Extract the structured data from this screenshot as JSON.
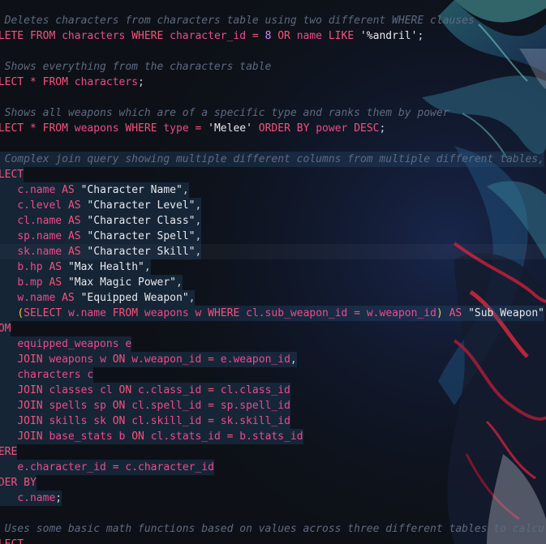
{
  "editor": {
    "language": "sql",
    "theme_colors": {
      "background": "#0d1117",
      "keyword": "#f7527a",
      "identifier": "#ee4a8a",
      "string": "#e8e8ee",
      "comment": "#5e6a80",
      "number": "#c78dfa",
      "selection": "#285278"
    },
    "lines": [
      {
        "comment": "- Deletes characters from characters table using two different WHERE clauses"
      },
      {
        "tokens": [
          [
            "kw",
            "ELETE FROM "
          ],
          [
            "id",
            "characters "
          ],
          [
            "kw",
            "WHERE "
          ],
          [
            "id",
            "character_id "
          ],
          [
            "op",
            "= "
          ],
          [
            "num",
            "8 "
          ],
          [
            "kw",
            "OR "
          ],
          [
            "id",
            "name "
          ],
          [
            "kw",
            "LIKE "
          ],
          [
            "str",
            "'%andril'"
          ],
          [
            "pl",
            ";"
          ]
        ]
      },
      {
        "comment": ""
      },
      {
        "comment": "- Shows everything from the characters table"
      },
      {
        "tokens": [
          [
            "kw",
            "ELECT "
          ],
          [
            "op",
            "* "
          ],
          [
            "kw",
            "FROM "
          ],
          [
            "id",
            "characters"
          ],
          [
            "pl",
            ";"
          ]
        ]
      },
      {
        "comment": ""
      },
      {
        "comment": "- Shows all weapons which are of a specific type and ranks them by power"
      },
      {
        "tokens": [
          [
            "kw",
            "ELECT "
          ],
          [
            "op",
            "* "
          ],
          [
            "kw",
            "FROM "
          ],
          [
            "id",
            "weapons "
          ],
          [
            "kw",
            "WHERE "
          ],
          [
            "id",
            "type "
          ],
          [
            "op",
            "= "
          ],
          [
            "str",
            "'Melee' "
          ],
          [
            "kw",
            "ORDER BY "
          ],
          [
            "id",
            "power "
          ],
          [
            "kw",
            "DESC"
          ],
          [
            "pl",
            ";"
          ]
        ]
      },
      {
        "comment": ""
      },
      {
        "comment": "- Complex join query showing multiple different columns from multiple different tables,",
        "selected": true
      },
      {
        "tokens": [
          [
            "kw",
            "ELECT"
          ]
        ],
        "selected": true
      },
      {
        "tokens": [
          [
            "pl",
            "    "
          ],
          [
            "id",
            "c.name "
          ],
          [
            "kw",
            "AS "
          ],
          [
            "str",
            "\"Character Name\""
          ],
          [
            "pl",
            ","
          ]
        ],
        "selected": true
      },
      {
        "tokens": [
          [
            "pl",
            "    "
          ],
          [
            "id",
            "c.level "
          ],
          [
            "kw",
            "AS "
          ],
          [
            "str",
            "\"Character Level\""
          ],
          [
            "pl",
            ","
          ]
        ],
        "selected": true
      },
      {
        "tokens": [
          [
            "pl",
            "    "
          ],
          [
            "id",
            "cl.name "
          ],
          [
            "kw",
            "AS "
          ],
          [
            "str",
            "\"Character Class\""
          ],
          [
            "pl",
            ","
          ]
        ],
        "selected": true
      },
      {
        "tokens": [
          [
            "pl",
            "    "
          ],
          [
            "id",
            "sp.name "
          ],
          [
            "kw",
            "AS "
          ],
          [
            "str",
            "\"Character Spell\""
          ],
          [
            "pl",
            ","
          ]
        ],
        "selected": true
      },
      {
        "tokens": [
          [
            "pl",
            "    "
          ],
          [
            "id",
            "sk.name "
          ],
          [
            "kw",
            "AS "
          ],
          [
            "str",
            "\"Character Skill\""
          ],
          [
            "pl",
            ","
          ]
        ],
        "selected": true,
        "cursor": true
      },
      {
        "tokens": [
          [
            "pl",
            "    "
          ],
          [
            "id",
            "b.hp "
          ],
          [
            "kw",
            "AS "
          ],
          [
            "str",
            "\"Max Health\""
          ],
          [
            "pl",
            ","
          ]
        ],
        "selected": true
      },
      {
        "tokens": [
          [
            "pl",
            "    "
          ],
          [
            "id",
            "b.mp "
          ],
          [
            "kw",
            "AS "
          ],
          [
            "str",
            "\"Max Magic Power\""
          ],
          [
            "pl",
            ","
          ]
        ],
        "selected": true
      },
      {
        "tokens": [
          [
            "pl",
            "    "
          ],
          [
            "id",
            "w.name "
          ],
          [
            "kw",
            "AS "
          ],
          [
            "str",
            "\"Equipped Weapon\""
          ],
          [
            "pl",
            ","
          ]
        ],
        "selected": true
      },
      {
        "tokens": [
          [
            "pl",
            "    "
          ],
          [
            "pa",
            "("
          ],
          [
            "kw",
            "SELECT "
          ],
          [
            "id",
            "w.name "
          ],
          [
            "kw",
            "FROM "
          ],
          [
            "id",
            "weapons w "
          ],
          [
            "kw",
            "WHERE "
          ],
          [
            "id",
            "cl.sub_weapon_id "
          ],
          [
            "op",
            "= "
          ],
          [
            "id",
            "w.weapon_id"
          ],
          [
            "pa",
            ") "
          ],
          [
            "kw",
            "AS "
          ],
          [
            "str",
            "\"Sub Weapon\""
          ]
        ],
        "selected": true
      },
      {
        "tokens": [
          [
            "kw",
            "ROM"
          ]
        ],
        "selected": true
      },
      {
        "tokens": [
          [
            "pl",
            "    "
          ],
          [
            "id",
            "equipped_weapons e"
          ]
        ],
        "selected": true
      },
      {
        "tokens": [
          [
            "pl",
            "    "
          ],
          [
            "kw",
            "JOIN "
          ],
          [
            "id",
            "weapons w "
          ],
          [
            "kw",
            "ON "
          ],
          [
            "id",
            "w.weapon_id "
          ],
          [
            "op",
            "= "
          ],
          [
            "id",
            "e.weapon_id"
          ],
          [
            "pl",
            ","
          ]
        ],
        "selected": true
      },
      {
        "tokens": [
          [
            "pl",
            "    "
          ],
          [
            "id",
            "characters c"
          ]
        ],
        "selected": true
      },
      {
        "tokens": [
          [
            "pl",
            "    "
          ],
          [
            "kw",
            "JOIN "
          ],
          [
            "id",
            "classes cl "
          ],
          [
            "kw",
            "ON "
          ],
          [
            "id",
            "c.class_id "
          ],
          [
            "op",
            "= "
          ],
          [
            "id",
            "cl.class_id"
          ]
        ],
        "selected": true
      },
      {
        "tokens": [
          [
            "pl",
            "    "
          ],
          [
            "kw",
            "JOIN "
          ],
          [
            "id",
            "spells sp "
          ],
          [
            "kw",
            "ON "
          ],
          [
            "id",
            "cl.spell_id "
          ],
          [
            "op",
            "= "
          ],
          [
            "id",
            "sp.spell_id"
          ]
        ],
        "selected": true
      },
      {
        "tokens": [
          [
            "pl",
            "    "
          ],
          [
            "kw",
            "JOIN "
          ],
          [
            "id",
            "skills sk "
          ],
          [
            "kw",
            "ON "
          ],
          [
            "id",
            "cl.skill_id "
          ],
          [
            "op",
            "= "
          ],
          [
            "id",
            "sk.skill_id"
          ]
        ],
        "selected": true
      },
      {
        "tokens": [
          [
            "pl",
            "    "
          ],
          [
            "kw",
            "JOIN "
          ],
          [
            "id",
            "base_stats b "
          ],
          [
            "kw",
            "ON "
          ],
          [
            "id",
            "cl.stats_id "
          ],
          [
            "op",
            "= "
          ],
          [
            "id",
            "b.stats_id"
          ]
        ],
        "selected": true
      },
      {
        "tokens": [
          [
            "kw",
            "HERE"
          ]
        ],
        "selected": true
      },
      {
        "tokens": [
          [
            "pl",
            "    "
          ],
          [
            "id",
            "e.character_id "
          ],
          [
            "op",
            "= "
          ],
          [
            "id",
            "c.character_id"
          ]
        ],
        "selected": true
      },
      {
        "tokens": [
          [
            "kw",
            "RDER BY"
          ]
        ],
        "selected": true
      },
      {
        "tokens": [
          [
            "pl",
            "    "
          ],
          [
            "id",
            "c.name"
          ],
          [
            "pl",
            ";"
          ]
        ],
        "selected": true
      },
      {
        "comment": ""
      },
      {
        "comment": "- Uses some basic math functions based on values across three different tables to calcul"
      },
      {
        "tokens": [
          [
            "kw",
            "ELECT"
          ]
        ]
      }
    ]
  }
}
